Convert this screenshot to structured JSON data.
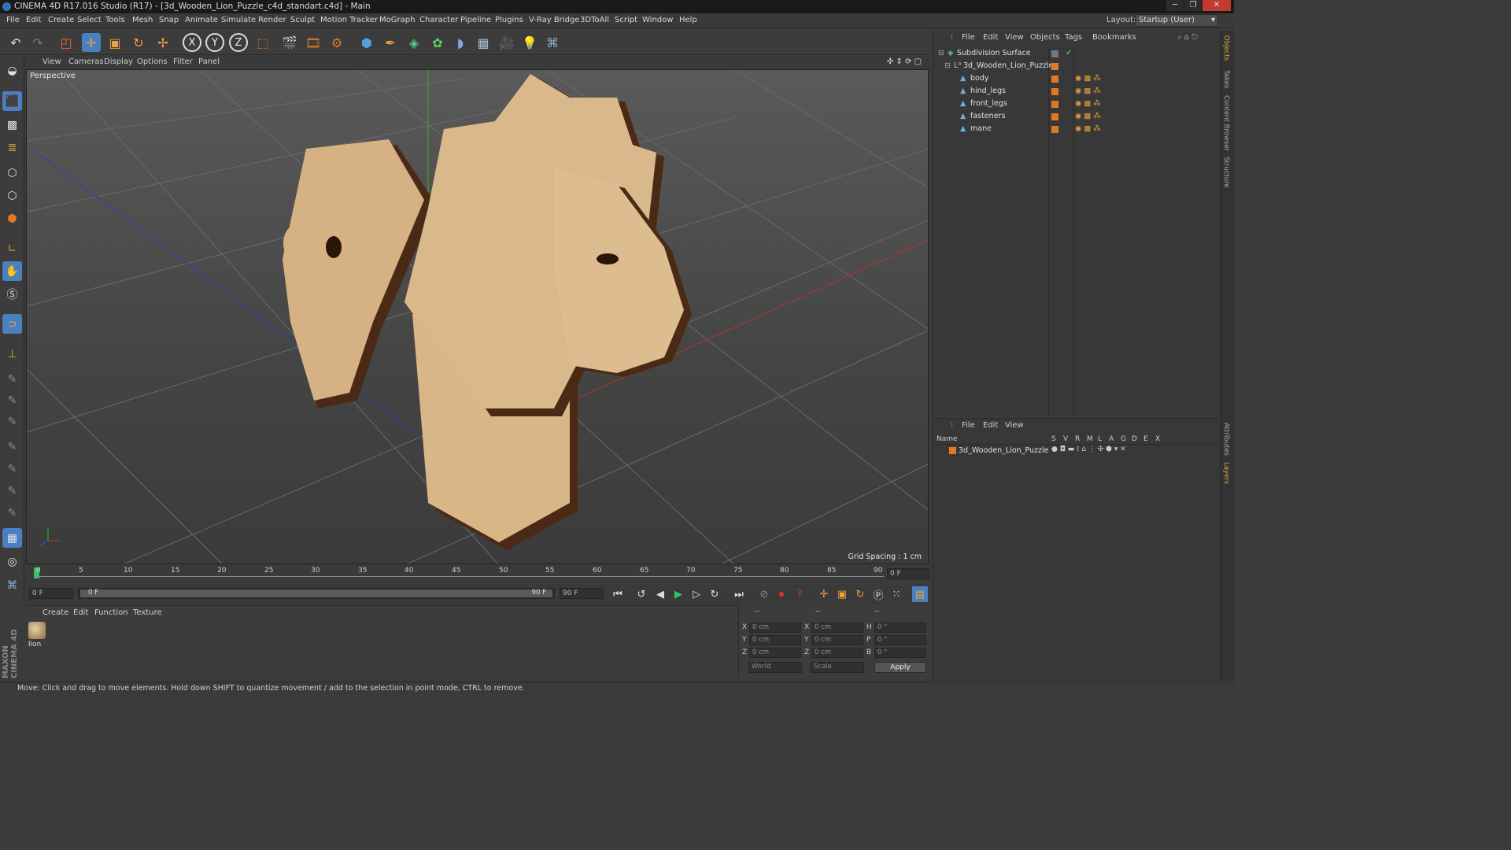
{
  "window": {
    "title": "CINEMA 4D R17.016 Studio (R17) - [3d_Wooden_Lion_Puzzle_c4d_standart.c4d] - Main",
    "controls": [
      "─",
      "❐",
      "✕"
    ]
  },
  "menubar": {
    "items": [
      "File",
      "Edit",
      "Create",
      "Select",
      "Tools",
      "Mesh",
      "Snap",
      "Animate",
      "Simulate",
      "Render",
      "Sculpt",
      "Motion Tracker",
      "MoGraph",
      "Character",
      "Pipeline",
      "Plugins",
      "V-Ray Bridge",
      "3DToAll",
      "Script",
      "Window",
      "Help"
    ],
    "layout_label": "Layout:",
    "layout_value": "Startup (User)"
  },
  "toolbar": {
    "icons": [
      "undo-icon",
      "redo-icon",
      "live-selection-icon",
      "move-icon",
      "scale-icon",
      "rotate-icon",
      "recent-tools-icon",
      "x-axis-icon",
      "y-axis-icon",
      "z-axis-icon",
      "coordinate-system-icon",
      "render-view-icon",
      "render-picture-viewer-icon",
      "edit-render-settings-icon",
      "cube-primitive-icon",
      "pen-spline-icon",
      "subdivision-generator-icon",
      "cloner-icon",
      "deformer-icon",
      "floor-icon",
      "camera-icon",
      "light-icon",
      "python-icon"
    ],
    "axis_labels": [
      "X",
      "Y",
      "Z"
    ]
  },
  "viewport": {
    "menu": [
      "View",
      "Cameras",
      "Display",
      "Options",
      "Filter",
      "Panel"
    ],
    "label": "Perspective",
    "grid_spacing": "Grid Spacing : 1 cm"
  },
  "timeline": {
    "ticks": [
      "0",
      "5",
      "10",
      "15",
      "20",
      "25",
      "30",
      "35",
      "40",
      "45",
      "50",
      "55",
      "60",
      "65",
      "70",
      "75",
      "80",
      "85",
      "90"
    ],
    "current_frame_field": "0 F",
    "start_field": "0 F",
    "range_start": "0 F",
    "range_end": "90 F",
    "end_field": "90 F"
  },
  "material_manager": {
    "menu": [
      "Create",
      "Edit",
      "Function",
      "Texture"
    ],
    "materials": [
      {
        "name": "lion"
      }
    ]
  },
  "coordinates": {
    "header": [
      "--",
      "--",
      "--"
    ],
    "rows": [
      {
        "axis": "X",
        "pos": "0 cm",
        "size_axis": "X",
        "size": "0 cm",
        "rot_axis": "H",
        "rot": "0 °"
      },
      {
        "axis": "Y",
        "pos": "0 cm",
        "size_axis": "Y",
        "size": "0 cm",
        "rot_axis": "P",
        "rot": "0 °"
      },
      {
        "axis": "Z",
        "pos": "0 cm",
        "size_axis": "Z",
        "size": "0 cm",
        "rot_axis": "B",
        "rot": "0 °"
      }
    ],
    "mode_select": "World",
    "size_select": "Scale",
    "apply": "Apply"
  },
  "object_manager": {
    "menu": [
      "File",
      "Edit",
      "View",
      "Objects",
      "Tags",
      "Bookmarks"
    ],
    "objects": [
      {
        "name": "Subdivision Surface",
        "level": 0
      },
      {
        "name": "3d_Wooden_Lion_Puzzle",
        "level": 1
      },
      {
        "name": "body",
        "level": 2
      },
      {
        "name": "hind_legs",
        "level": 2
      },
      {
        "name": "front_legs",
        "level": 2
      },
      {
        "name": "fasteners",
        "level": 2
      },
      {
        "name": "mane",
        "level": 2
      }
    ]
  },
  "layer_manager": {
    "menu": [
      "File",
      "Edit",
      "View"
    ],
    "columns": [
      "Name",
      "S",
      "V",
      "R",
      "M",
      "L",
      "A",
      "G",
      "D",
      "E",
      "X"
    ],
    "layers": [
      {
        "name": "3d_Wooden_Lion_Puzzle"
      }
    ]
  },
  "side_tabs": [
    "Objects",
    "Takes",
    "Content Browser",
    "Structure",
    "Attributes",
    "Layers"
  ],
  "status": "Move: Click and drag to move elements. Hold down SHIFT to quantize movement / add to the selection in point mode, CTRL to remove.",
  "branding": "MAXON CINEMA 4D",
  "colors": {
    "accent": "#e07a22",
    "selection_blue": "#4a7fc0",
    "wood": "#d6b184",
    "wood_dark": "#4a2a14"
  }
}
